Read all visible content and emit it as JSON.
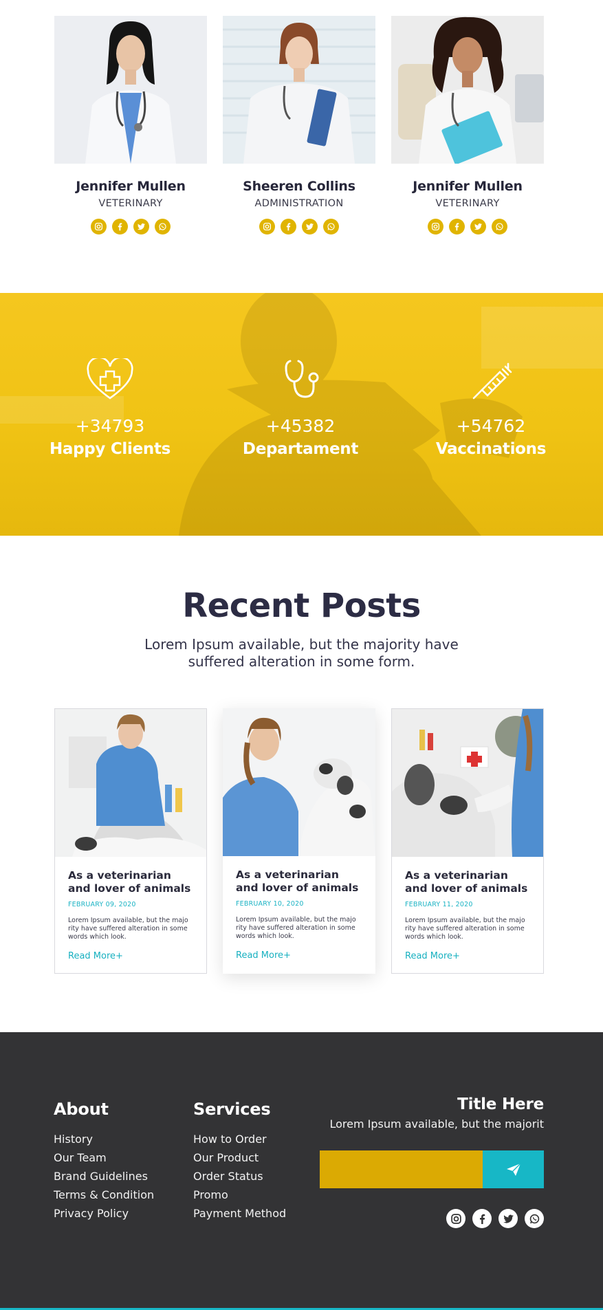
{
  "team": {
    "members": [
      {
        "name": "Jennifer Mullen",
        "role": "VETERINARY"
      },
      {
        "name": "Sheeren Collins",
        "role": "ADMINISTRATION"
      },
      {
        "name": "Jennifer Mullen",
        "role": "VETERINARY"
      }
    ],
    "social_icons": [
      "instagram-icon",
      "facebook-icon",
      "twitter-icon",
      "whatsapp-icon"
    ]
  },
  "stats": [
    {
      "value": "+34793",
      "label": "Happy Clients",
      "icon": "heart-plus-icon"
    },
    {
      "value": "+45382",
      "label": "Departament",
      "icon": "stethoscope-icon"
    },
    {
      "value": "+54762",
      "label": "Vaccinations",
      "icon": "syringe-icon"
    }
  ],
  "posts": {
    "title": "Recent Posts",
    "subtitle": "Lorem Ipsum available, but the majority have suffered alteration in some form.",
    "items": [
      {
        "title": "As a veterinarian and lover of animals",
        "date": "FEBRUARY 09, 2020",
        "text": "Lorem Ipsum available, but the majo rity have suffered alteration in some words which look.",
        "link": "Read More+"
      },
      {
        "title": "As a veterinarian and lover of animals",
        "date": "FEBRUARY 10, 2020",
        "text": "Lorem Ipsum available, but the majo rity have suffered alteration in some words which look.",
        "link": "Read More+"
      },
      {
        "title": "As a veterinarian and lover of animals",
        "date": "FEBRUARY 11, 2020",
        "text": "Lorem Ipsum available, but the majo rity have suffered alteration in some words which look.",
        "link": "Read More+"
      }
    ]
  },
  "footer": {
    "about": {
      "heading": "About",
      "links": [
        "History",
        "Our Team",
        "Brand Guidelines",
        "Terms & Condition",
        "Privacy Policy"
      ]
    },
    "services": {
      "heading": "Services",
      "links": [
        "How to Order",
        "Our Product",
        "Order Status",
        "Promo",
        "Payment Method"
      ]
    },
    "newsletter": {
      "heading": "Title Here",
      "tagline": "Lorem Ipsum available, but the majorit",
      "input_value": ""
    },
    "social_icons": [
      "instagram-icon",
      "facebook-icon",
      "twitter-icon",
      "whatsapp-icon"
    ]
  },
  "colors": {
    "accent_yellow": "#f2c418",
    "accent_teal": "#17b7c6",
    "footer_bg": "#333335",
    "dark_text": "#2c2c44"
  }
}
